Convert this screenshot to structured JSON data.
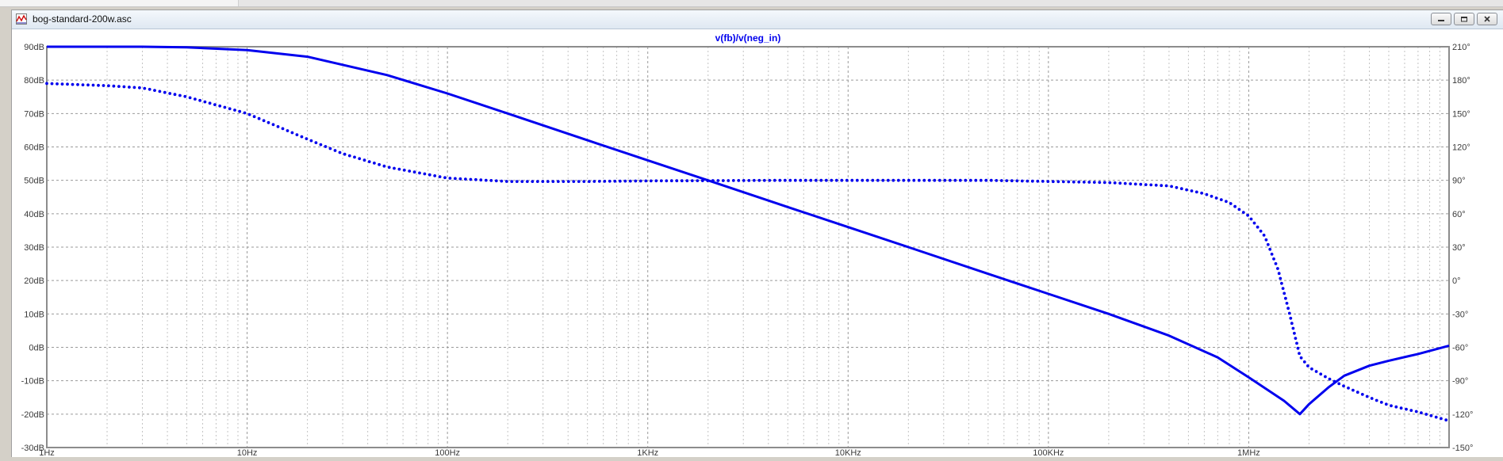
{
  "window": {
    "title": "bog-standard-200w.asc",
    "buttons": {
      "minimize": "minimize-icon",
      "restore": "restore-icon",
      "close": "close-icon"
    }
  },
  "colors": {
    "trace": "#0000ee",
    "grid": "#9a9a9a",
    "axis": "#8c8c8c",
    "label": "#3a3a3a"
  },
  "chart_data": {
    "type": "line",
    "title": "v(fb)/v(neg_in)",
    "x_scale": "log",
    "xlim": [
      1,
      10000000
    ],
    "x_ticks": [
      {
        "value": 1,
        "label": "1Hz"
      },
      {
        "value": 10,
        "label": "10Hz"
      },
      {
        "value": 100,
        "label": "100Hz"
      },
      {
        "value": 1000,
        "label": "1KHz"
      },
      {
        "value": 10000,
        "label": "10KHz"
      },
      {
        "value": 100000,
        "label": "100KHz"
      },
      {
        "value": 1000000,
        "label": "1MHz"
      }
    ],
    "ylim_left": [
      -30,
      90
    ],
    "y_ticks_left": [
      "90dB",
      "80dB",
      "70dB",
      "60dB",
      "50dB",
      "40dB",
      "30dB",
      "20dB",
      "10dB",
      "0dB",
      "-10dB",
      "-20dB",
      "-30dB"
    ],
    "ylim_right": [
      -150,
      210
    ],
    "y_ticks_right": [
      "210°",
      "180°",
      "150°",
      "120°",
      "90°",
      "60°",
      "30°",
      "0°",
      "-30°",
      "-60°",
      "-90°",
      "-120°",
      "-150°"
    ],
    "grid": true,
    "series": [
      {
        "style": "solid",
        "axis": "left",
        "x": [
          1,
          2,
          3,
          5,
          10,
          20,
          50,
          100,
          200,
          500,
          1000,
          2000,
          5000,
          10000,
          20000,
          50000,
          100000,
          200000,
          400000,
          700000,
          1000000,
          1500000,
          1800000,
          2000000,
          2500000,
          3000000,
          4000000,
          5000000,
          7000000,
          10000000
        ],
        "y": [
          90,
          90,
          90,
          89.8,
          89,
          87,
          81.5,
          76,
          70,
          62,
          56,
          50,
          42,
          36,
          30,
          22,
          16,
          10,
          3.5,
          -3,
          -9,
          -16,
          -20,
          -17,
          -12,
          -8.5,
          -5.5,
          -4,
          -2,
          0.5
        ]
      },
      {
        "style": "dotted",
        "axis": "right",
        "x": [
          1,
          2,
          3,
          5,
          10,
          20,
          30,
          50,
          100,
          200,
          500,
          1000,
          5000,
          50000,
          200000,
          400000,
          600000,
          800000,
          1000000,
          1200000,
          1400000,
          1600000,
          1800000,
          2000000,
          2500000,
          3000000,
          4000000,
          5000000,
          7000000,
          10000000
        ],
        "y": [
          177,
          175,
          173,
          165,
          150,
          127,
          114,
          102,
          92,
          89,
          89,
          89.5,
          90,
          90,
          88,
          85,
          78,
          70,
          58,
          40,
          10,
          -30,
          -68,
          -78,
          -88,
          -95,
          -105,
          -112,
          -118,
          -126
        ]
      }
    ]
  }
}
